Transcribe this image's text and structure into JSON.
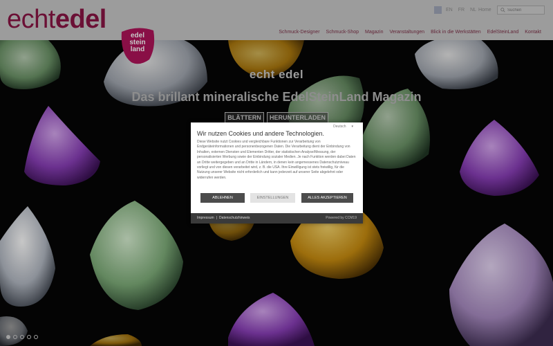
{
  "header": {
    "logo_light": "echt",
    "logo_bold": "edel",
    "badge_lines": [
      "edel",
      "stein",
      "land"
    ],
    "languages": [
      "EN",
      "FR",
      "NL"
    ],
    "home": "Home",
    "search_placeholder": "Suchen",
    "nav": [
      "Schmuck-Designer",
      "Schmuck-Shop",
      "Magazin",
      "Veranstaltungen",
      "Blick in die Werkstätten",
      "EdelSteinLand",
      "Kontakt"
    ]
  },
  "hero": {
    "title": "echt edel",
    "subtitle": "Das brillant mineralische EdelSteinLand Magazin",
    "button_blaettern": "BLÄTTERN",
    "button_herunterladen": "HERUNTERLADEN",
    "slides": 5,
    "active_slide": 1
  },
  "cookie": {
    "language": "Deutsch",
    "title": "Wir nutzen Cookies und andere Technologien.",
    "text": "Diese Website nutzt Cookies und vergleichbare Funktionen zur Verarbeitung von Endgeräteinformationen und personenbezogenen Daten. Die Verarbeitung dient der Einbindung von Inhalten, externen Diensten und Elementen Dritter, der statistischen Analyse/Messung, der personalisierten Werbung sowie der Einbindung sozialer Medien. Je nach Funktion werden dabei Daten an Dritte weitergegeben und an Dritte in Ländern, in denen kein angemessenes Datenschutzniveau vorliegt und von diesen verarbeitet wird, z. B. die USA. Ihre Einwilligung ist stets freiwillig, für die Nutzung unserer Website nicht erforderlich und kann jederzeit auf unserer Seite abgelehnt oder widerrufen werden.",
    "btn_reject": "ABLEHNEN",
    "btn_settings": "EINSTELLUNGEN",
    "btn_accept": "ALLES AKZEPTIEREN",
    "footer_impressum": "Impressum",
    "footer_separator": "|",
    "footer_datenschutz": "Datenschutzhinweis",
    "footer_powered": "Powered by CCM19"
  },
  "colors": {
    "brand": "#8a1545",
    "header_bg": "#c8c8c8"
  }
}
